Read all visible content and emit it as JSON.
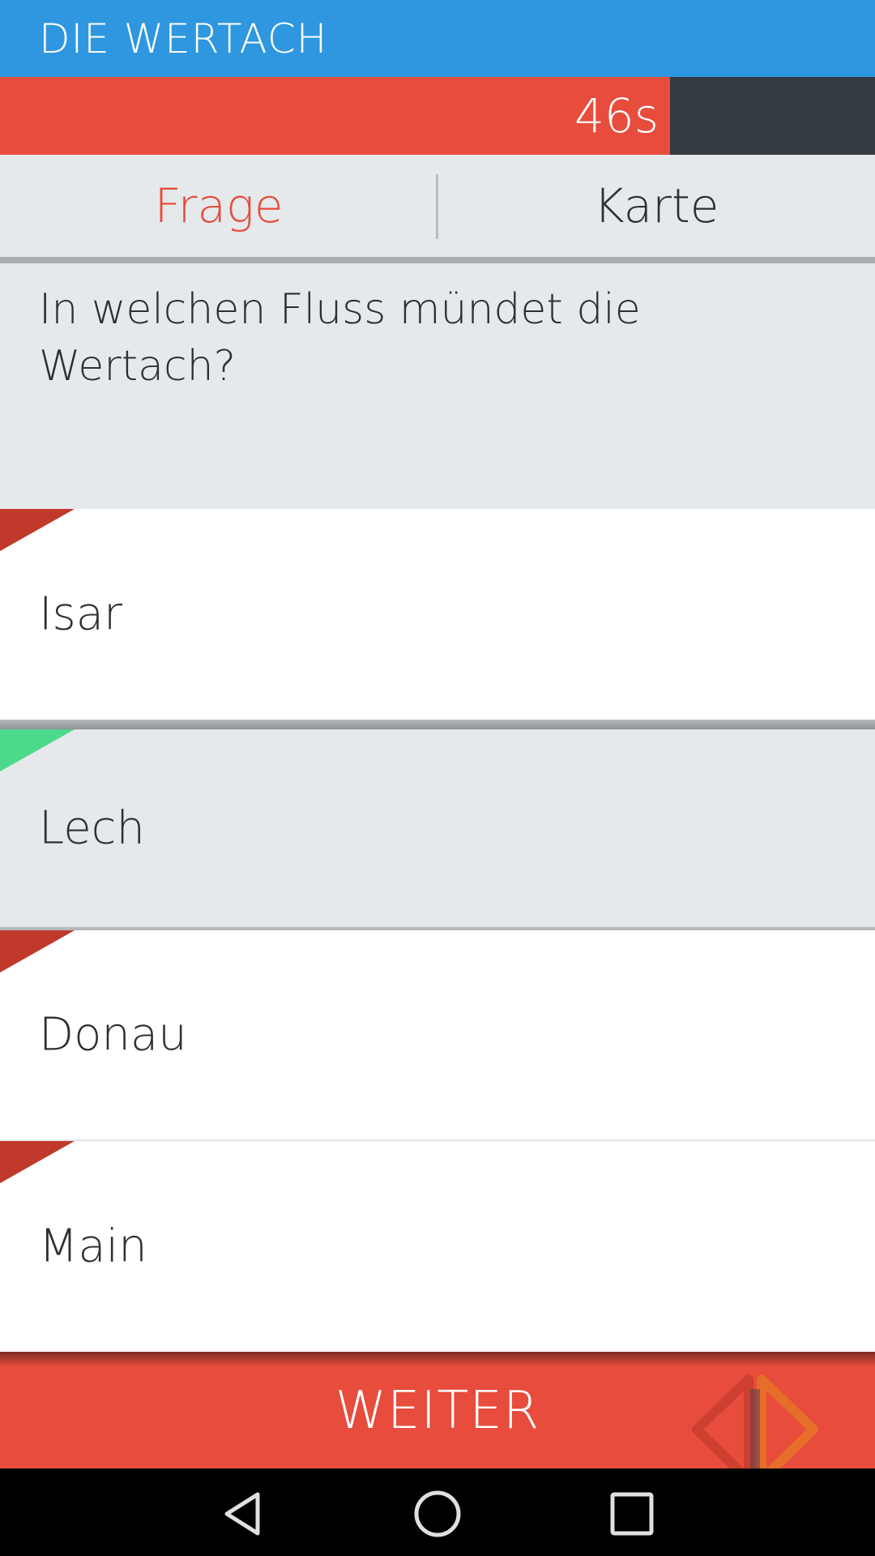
{
  "appbar": {
    "title": "DIE WERTACH"
  },
  "timer": {
    "label": "46s",
    "remaining_fraction": 0.766
  },
  "tabs": [
    {
      "label": "Frage",
      "active": true
    },
    {
      "label": "Karte",
      "active": false
    }
  ],
  "question": {
    "text": "In welchen Fluss mündet die Wertach?"
  },
  "answers": [
    {
      "label": "Isar",
      "marker": "incorrect",
      "selected": false
    },
    {
      "label": "Lech",
      "marker": "correct",
      "selected": true
    },
    {
      "label": "Donau",
      "marker": "incorrect",
      "selected": false
    },
    {
      "label": "Main",
      "marker": "incorrect",
      "selected": false
    }
  ],
  "footer": {
    "button_label": "WEITER"
  },
  "navbar": {
    "icons": [
      "back-icon",
      "home-icon",
      "recents-icon"
    ]
  },
  "colors": {
    "appbar": "#2f97df",
    "accent_red": "#e74c3c",
    "timer_track": "#343a41",
    "correct_green": "#4cd98b",
    "incorrect_red": "#c0392b"
  }
}
